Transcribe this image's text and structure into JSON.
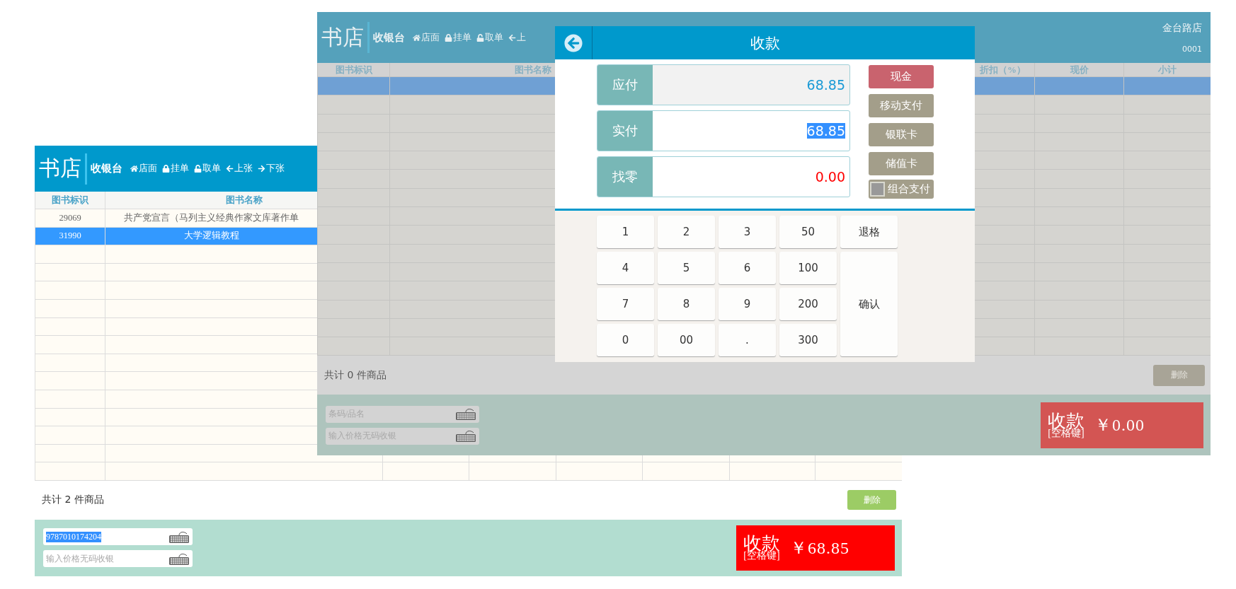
{
  "back_window": {
    "dimmed": false,
    "header": {
      "logo": "书店",
      "title": "收银台",
      "nav": [
        {
          "kind": "home",
          "label": "店面"
        },
        {
          "kind": "lock",
          "label": "挂单"
        },
        {
          "kind": "unlock",
          "label": "取单"
        },
        {
          "kind": "prev",
          "label": "上张"
        },
        {
          "kind": "next",
          "label": "下张"
        }
      ]
    },
    "table": {
      "columns": [
        "图书标识",
        "图书名称"
      ],
      "rows": [
        {
          "cells": [
            "29069",
            "共产党宣言（马列主义经典作家文库著作单"
          ],
          "selected": false
        },
        {
          "cells": [
            "31990",
            "大学逻辑教程"
          ],
          "selected": true
        }
      ]
    },
    "summary": "共计 2 件商品",
    "delete_button": "删除",
    "barcode_field": {
      "value": "9787010174204"
    },
    "price_field": {
      "placeholder": "输入价格无码收银"
    },
    "pay_button": {
      "label": "收款",
      "hint": "[空格键]",
      "amount": "￥68.85"
    }
  },
  "front_window": {
    "dimmed": true,
    "header": {
      "logo": "书店",
      "title": "收银台",
      "nav": [
        {
          "kind": "home",
          "label": "店面"
        },
        {
          "kind": "lock",
          "label": "挂单"
        },
        {
          "kind": "unlock",
          "label": "取单"
        },
        {
          "kind": "prev",
          "label": "上"
        }
      ],
      "store": "金台路店",
      "terminal": "0001"
    },
    "table": {
      "columns": [
        "图书标识",
        "图书名称",
        "折扣（%）",
        "现价",
        "小计"
      ],
      "rows": [
        {
          "selected": true
        }
      ]
    },
    "summary": "共计 0 件商品",
    "delete_button": "删除",
    "barcode_field": {
      "placeholder": "条码/品名"
    },
    "price_field": {
      "placeholder": "输入价格无码收银"
    },
    "pay_button": {
      "label": "收款",
      "hint": "[空格键]",
      "amount": "￥0.00"
    }
  },
  "payment_dialog": {
    "title": "收款",
    "amounts": [
      {
        "kind": "due",
        "label": "应付",
        "value": "68.85"
      },
      {
        "kind": "paid",
        "label": "实付",
        "value": "68.85"
      },
      {
        "kind": "change",
        "label": "找零",
        "value": "0.00"
      }
    ],
    "methods": [
      {
        "label": "现金",
        "selected": true
      },
      {
        "label": "移动支付",
        "selected": false
      },
      {
        "label": "银联卡",
        "selected": false
      },
      {
        "label": "储值卡",
        "selected": false
      }
    ],
    "combined": {
      "label": "组合支付",
      "checked": false
    },
    "key_rows": [
      [
        "1",
        "2",
        "3",
        "50"
      ],
      [
        "4",
        "5",
        "6",
        "100"
      ],
      [
        "7",
        "8",
        "9",
        "200"
      ],
      [
        "0",
        "00",
        ".",
        "300"
      ]
    ],
    "backspace": "退格",
    "confirm": "确认"
  }
}
